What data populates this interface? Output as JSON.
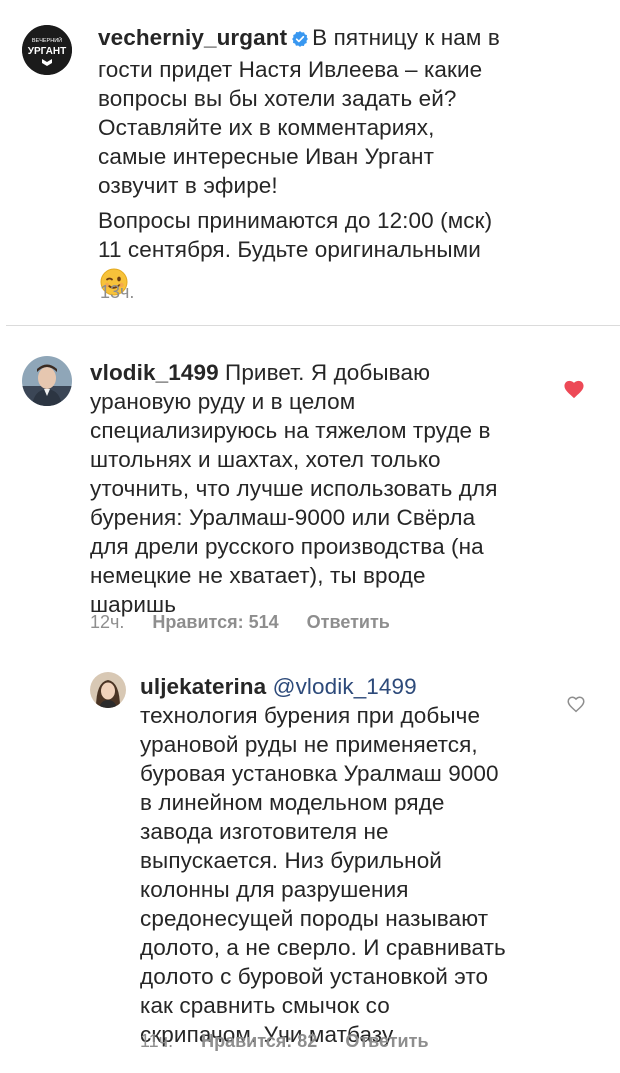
{
  "post": {
    "username": "vecherniy_urgant",
    "verified": true,
    "caption_lines": [
      "В пятницу к нам в",
      "гости придет Настя Ивлеева – какие",
      "вопросы вы бы хотели задать ей?",
      "Оставляйте их в комментариях,",
      "самые интересные Иван Ургант",
      "озвучит в эфире!"
    ],
    "caption2_lines": [
      "Вопросы принимаются до 12:00 (мск)",
      "11 сентября. Будьте оригинальными"
    ],
    "emoji": "winking-face",
    "time": "13ч.",
    "avatar_text": [
      "ВЕЧЕРНИЙ",
      "УРГАНТ"
    ]
  },
  "comment1": {
    "username": "vlodik_1499",
    "text_lines": [
      "Привет. Я добываю",
      "урановую руду и в целом",
      "специализируюсь на тяжелом труде в",
      "штольнях и шахтах, хотел только",
      "уточнить, что лучше использовать для",
      "бурения: Уралмаш-9000 или Свёрла",
      "для дрели русского производства (на",
      "немецкие не хватает), ты вроде",
      "шаришь"
    ],
    "time": "12ч.",
    "likes": "Нравится: 514",
    "reply": "Ответить",
    "liked": true,
    "like_color": "#ed4956"
  },
  "reply1": {
    "username": "uljekaterina",
    "mention": "@vlodik_1499",
    "text_lines": [
      "технология бурения при добыче",
      "урановой руды не применяется,",
      "буровая установка Уралмаш 9000",
      "в линейном модельном ряде",
      "завода изготовителя не",
      "выпускается. Низ бурильной",
      "колонны для разрушения",
      "средонесущей породы называют",
      "долото, а не сверло. И сравнивать",
      "долото с буровой установкой это",
      "как сравнить смычок со",
      "скрипачом. Учи матбазу"
    ],
    "time": "11ч.",
    "likes": "Нравится: 82",
    "reply": "Ответить",
    "liked": false
  }
}
